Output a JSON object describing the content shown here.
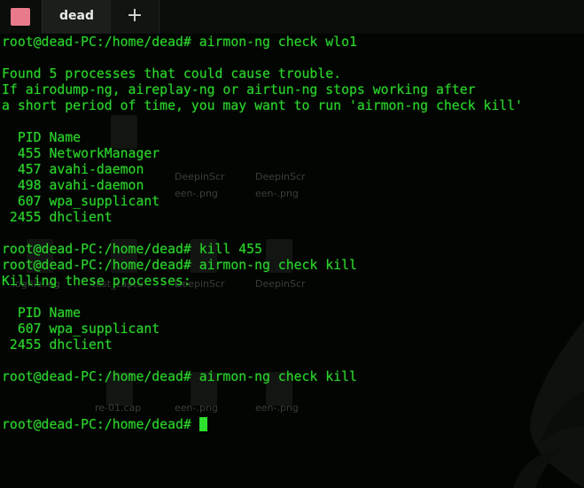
{
  "tabs": [
    {
      "label": "dead"
    }
  ],
  "prompt": "root@dead-PC:/home/dead#",
  "terminal": {
    "lines": [
      "root@dead-PC:/home/dead# airmon-ng check wlo1",
      "",
      "Found 5 processes that could cause trouble.",
      "If airodump-ng, aireplay-ng or airtun-ng stops working after",
      "a short period of time, you may want to run 'airmon-ng check kill'",
      "",
      "  PID Name",
      "  455 NetworkManager",
      "  457 avahi-daemon",
      "  498 avahi-daemon",
      "  607 wpa_supplicant",
      " 2455 dhclient",
      "",
      "root@dead-PC:/home/dead# kill 455",
      "root@dead-PC:/home/dead# airmon-ng check kill",
      "Killing these processes:",
      "",
      "  PID Name",
      "  607 wpa_supplicant",
      " 2455 dhclient",
      "",
      "root@dead-PC:/home/dead# airmon-ng check kill",
      "",
      "",
      "root@dead-PC:/home/dead#"
    ]
  },
  "desktop_ghost": {
    "labels": [
      "DeepinScr",
      "DeepinScr",
      "een-.png",
      "een-.png",
      "logfile.log",
      "test_captu",
      "DeepinScr",
      "DeepinScr",
      "re-01.cap",
      "een-.png",
      "een-.png"
    ]
  },
  "colors": {
    "terminal_text": "#2bd12b",
    "tab_close": "#e87a8c",
    "background": "#030503"
  }
}
